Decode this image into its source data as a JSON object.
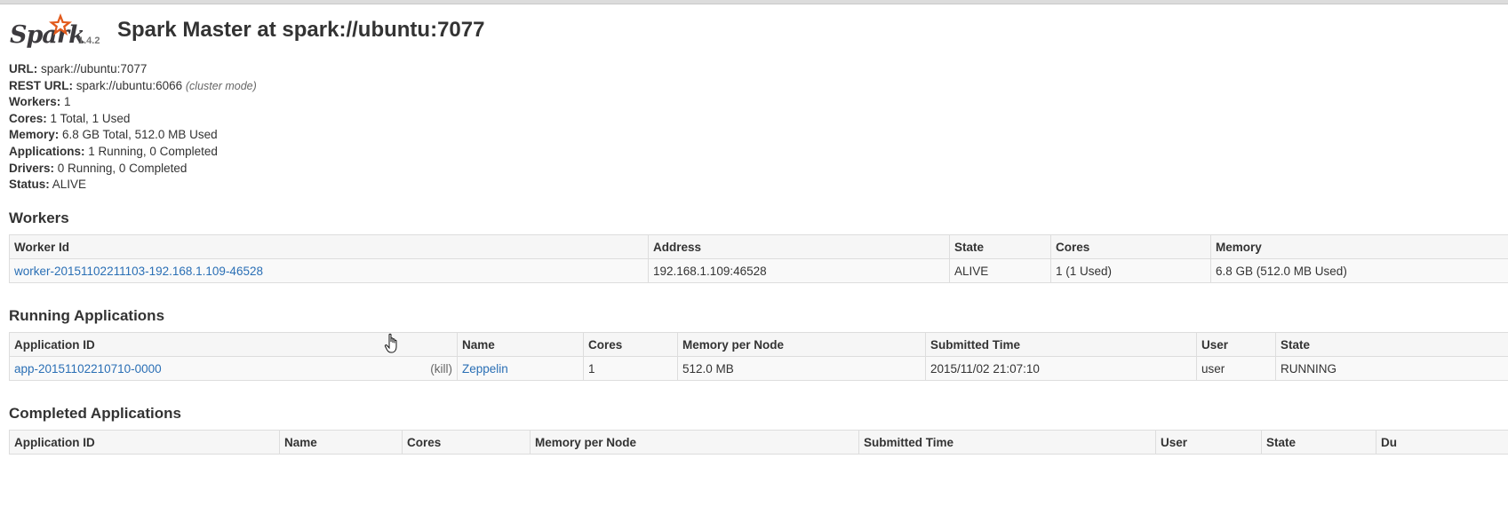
{
  "header": {
    "logo_text": "Spark",
    "version": "1.4.2",
    "title": "Spark Master at spark://ubuntu:7077"
  },
  "info": [
    {
      "label": "URL:",
      "value": "spark://ubuntu:7077",
      "note": ""
    },
    {
      "label": "REST URL:",
      "value": "spark://ubuntu:6066",
      "note": "(cluster mode)"
    },
    {
      "label": "Workers:",
      "value": "1",
      "note": ""
    },
    {
      "label": "Cores:",
      "value": "1 Total, 1 Used",
      "note": ""
    },
    {
      "label": "Memory:",
      "value": "6.8 GB Total, 512.0 MB Used",
      "note": ""
    },
    {
      "label": "Applications:",
      "value": "1 Running, 0 Completed",
      "note": ""
    },
    {
      "label": "Drivers:",
      "value": "0 Running, 0 Completed",
      "note": ""
    },
    {
      "label": "Status:",
      "value": "ALIVE",
      "note": ""
    }
  ],
  "workers": {
    "heading": "Workers",
    "columns": [
      "Worker Id",
      "Address",
      "State",
      "Cores",
      "Memory"
    ],
    "rows": [
      {
        "id": "worker-20151102211103-192.168.1.109-46528",
        "address": "192.168.1.109:46528",
        "state": "ALIVE",
        "cores": "1 (1 Used)",
        "memory": "6.8 GB (512.0 MB Used)"
      }
    ]
  },
  "running": {
    "heading": "Running Applications",
    "columns": [
      "Application ID",
      "Name",
      "Cores",
      "Memory per Node",
      "Submitted Time",
      "User",
      "State"
    ],
    "rows": [
      {
        "id": "app-20151102210710-0000",
        "kill": "(kill)",
        "name": "Zeppelin",
        "cores": "1",
        "memory": "512.0 MB",
        "submitted": "2015/11/02 21:07:10",
        "user": "user",
        "state": "RUNNING"
      }
    ]
  },
  "completed": {
    "heading": "Completed Applications",
    "columns": [
      "Application ID",
      "Name",
      "Cores",
      "Memory per Node",
      "Submitted Time",
      "User",
      "State",
      "Du"
    ]
  },
  "colors": {
    "link": "#2a6fb5",
    "logo_orange": "#e25a1c",
    "text": "#333333"
  },
  "icons": [
    "spark-star-icon",
    "mouse-pointer-icon"
  ]
}
